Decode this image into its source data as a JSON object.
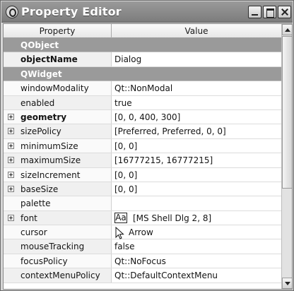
{
  "window": {
    "title": "Property Editor"
  },
  "table": {
    "header": {
      "property": "Property",
      "value": "Value"
    },
    "rows": [
      {
        "kind": "group",
        "label": "QObject"
      },
      {
        "kind": "prop",
        "name": "objectName",
        "value": "Dialog",
        "bold": true
      },
      {
        "kind": "group",
        "label": "QWidget"
      },
      {
        "kind": "prop",
        "name": "windowModality",
        "value": "Qt::NonModal"
      },
      {
        "kind": "prop",
        "name": "enabled",
        "value": "true"
      },
      {
        "kind": "prop",
        "name": "geometry",
        "value": "[0, 0, 400, 300]",
        "bold": true,
        "expandable": true
      },
      {
        "kind": "prop",
        "name": "sizePolicy",
        "value": "[Preferred, Preferred, 0, 0]",
        "expandable": true
      },
      {
        "kind": "prop",
        "name": "minimumSize",
        "value": "[0, 0]",
        "expandable": true
      },
      {
        "kind": "prop",
        "name": "maximumSize",
        "value": "[16777215, 16777215]",
        "expandable": true
      },
      {
        "kind": "prop",
        "name": "sizeIncrement",
        "value": "[0, 0]",
        "expandable": true
      },
      {
        "kind": "prop",
        "name": "baseSize",
        "value": "[0, 0]",
        "expandable": true
      },
      {
        "kind": "prop",
        "name": "palette",
        "value": ""
      },
      {
        "kind": "prop",
        "name": "font",
        "value": "[MS Shell Dlg 2, 8]",
        "expandable": true,
        "icon": "font-icon",
        "icon_glyph": "Aa"
      },
      {
        "kind": "prop",
        "name": "cursor",
        "value": "Arrow",
        "icon": "arrow-cursor-icon"
      },
      {
        "kind": "prop",
        "name": "mouseTracking",
        "value": "false"
      },
      {
        "kind": "prop",
        "name": "focusPolicy",
        "value": "Qt::NoFocus"
      },
      {
        "kind": "prop",
        "name": "contextMenuPolicy",
        "value": "Qt::DefaultContextMenu"
      }
    ]
  },
  "colors": {
    "group_row": "#9a9a9a",
    "titlebar": "#808080"
  }
}
